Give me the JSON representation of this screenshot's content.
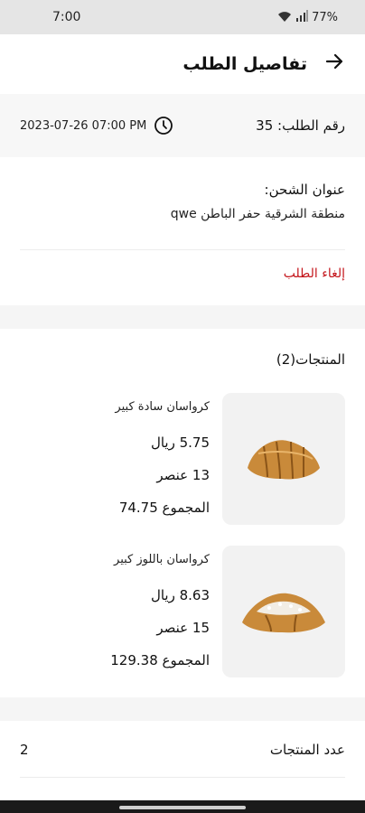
{
  "status_bar": {
    "time": "7:00",
    "battery": "77%",
    "wifi_icon": "wifi-icon",
    "signal_icon": "signal-icon"
  },
  "app_bar": {
    "title": "تفاصيل الطلب",
    "back_icon": "arrow-right-icon"
  },
  "order": {
    "number_label": "رقم الطلب: 35",
    "datetime": "2023-07-26 07:00 PM",
    "clock_icon": "clock-icon"
  },
  "shipping": {
    "label": "عنوان الشحن:",
    "address": "منطقة الشرقية حفر الباطن qwe"
  },
  "cancel_label": "إلغاء الطلب",
  "products": {
    "title": "المنتجات(2)",
    "items": [
      {
        "name": "كرواسان سادة كبير",
        "price": "5.75 ريال",
        "quantity": "13 عنصر",
        "total": "المجموع 74.75",
        "image_icon": "croissant-plain-image"
      },
      {
        "name": "كرواسان باللوز كبير",
        "price": "8.63 ريال",
        "quantity": "15 عنصر",
        "total": "المجموع 129.38",
        "image_icon": "croissant-almond-image"
      }
    ]
  },
  "summary": {
    "items_count_label": "عدد المنتجات",
    "items_count_value": "2"
  },
  "colors": {
    "accent_red": "#c4161c",
    "section_band": "#f5f5f5",
    "card_bg": "#f2f2f2"
  }
}
